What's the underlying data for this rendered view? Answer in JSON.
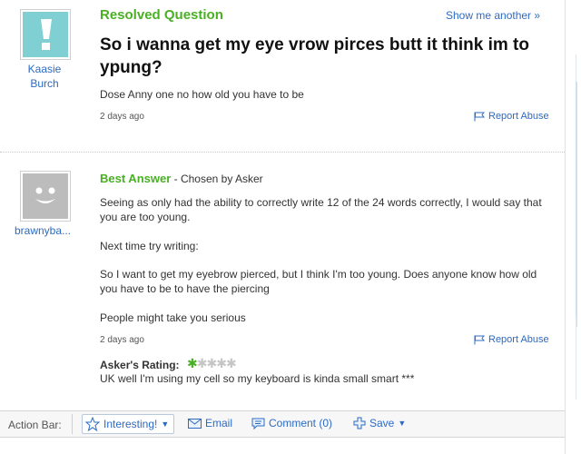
{
  "question": {
    "status": "Resolved Question",
    "show_another": "Show me another »",
    "title": "So i wanna get my eye vrow pirces butt it think im to ypung?",
    "body": "Dose Anny one no how old you have to be",
    "time": "2 days ago",
    "report": "Report Abuse",
    "asker": {
      "name": "Kaasie Burch",
      "avatar_icon": "exclamation-avatar-icon"
    }
  },
  "answer": {
    "heading": "Best Answer",
    "chosen": " - Chosen by Asker",
    "answerer": {
      "name": "brawnyba...",
      "avatar_icon": "default-smiley-avatar-icon"
    },
    "paragraphs": [
      "Seeing as only had the ability to correctly write 12 of the 24 words correctly, I would say that you are too young.",
      "Next time try writing:",
      "So I want to get my eyebrow pierced, but I think I'm too young. Does anyone know how old you have to be to have the piercing",
      "People might take you serious"
    ],
    "time": "2 days ago",
    "report": "Report Abuse",
    "rating_label": "Asker's Rating:",
    "rating": {
      "value": 1,
      "max": 5
    },
    "rating_comment": "UK well I'm using my cell so my keyboard is kinda small smart ***"
  },
  "action_bar": {
    "label": "Action Bar:",
    "interesting": "Interesting!",
    "email": "Email",
    "comment": "Comment (0)",
    "save": "Save"
  },
  "colors": {
    "accent_green": "#49b024",
    "link_blue": "#2c6bc3",
    "asker_avatar": "#7fcfd3",
    "answerer_avatar": "#bcbcbc"
  }
}
